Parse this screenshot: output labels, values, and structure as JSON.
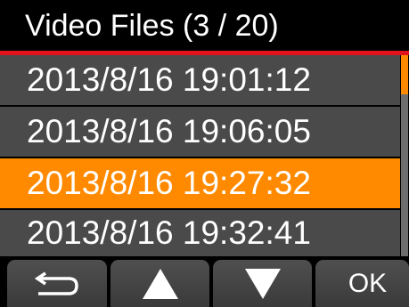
{
  "header": {
    "title": "Video Files (3 / 20)",
    "rule_color": "#e0121b"
  },
  "files": {
    "items": [
      {
        "label": "2013/8/16 19:01:12",
        "selected": false
      },
      {
        "label": "2013/8/16 19:06:05",
        "selected": false
      },
      {
        "label": "2013/8/16 19:27:32",
        "selected": true
      },
      {
        "label": "2013/8/16 19:32:41",
        "selected": false
      }
    ],
    "selected_color": "#ff8a00",
    "row_color": "#4a4a4a"
  },
  "scrollbar": {
    "position": 3,
    "total": 20
  },
  "footer": {
    "back_icon": "return-arrow-icon",
    "up_icon": "triangle-up-icon",
    "down_icon": "triangle-down-icon",
    "ok_label": "OK"
  }
}
